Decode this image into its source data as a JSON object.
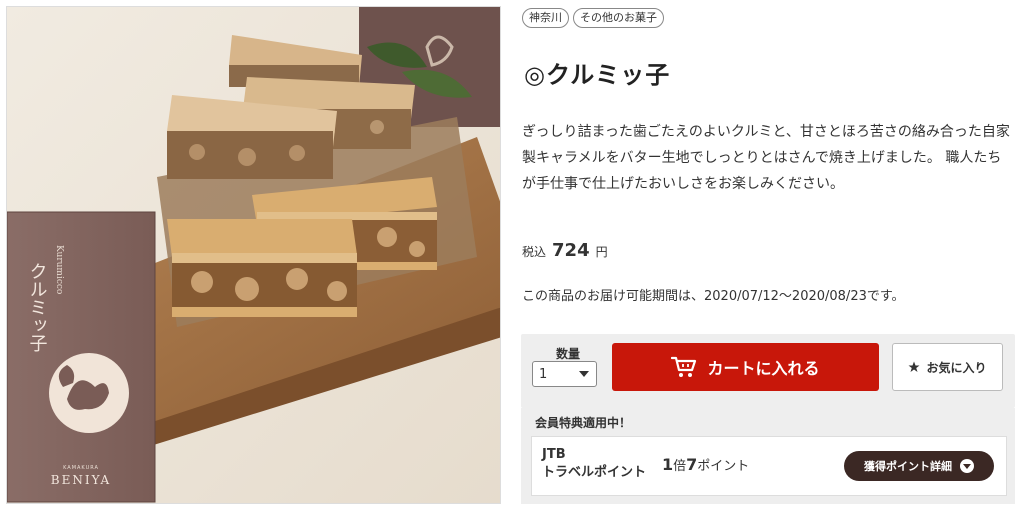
{
  "product_image": {
    "box_title": "クルミッ子",
    "box_subtitle": "Kurumicco",
    "box_brand_top": "KAMAKURA",
    "box_brand": "BENIYA"
  },
  "tags": [
    "神奈川",
    "その他のお菓子"
  ],
  "title": "◎クルミッ子",
  "description": "ぎっしり詰まった歯ごたえのよいクルミと、甘さとほろ苦さの絡み合った自家製キャラメルをバター生地でしっとりとはさんで焼き上げました。 職人たちが手仕事で仕上げたおいしさをお楽しみください。",
  "price": {
    "label": "税込",
    "value": "724",
    "unit": "円"
  },
  "delivery": "この商品のお届け可能期間は、2020/07/12～2020/08/23です。",
  "cart": {
    "qty_label": "数量",
    "qty_value": "1",
    "add_to_cart": "カートに入れる",
    "favorite": "お気に入り"
  },
  "member": {
    "label": "会員特典適用中！",
    "brand_line1": "JTB",
    "brand_line2": "トラベルポイント",
    "rate_num1": "1",
    "rate_unit1": "倍",
    "rate_num2": "7",
    "rate_unit2": "ポイント",
    "details_button": "獲得ポイント詳細"
  },
  "colors": {
    "cart_button": "#c8170a",
    "points_button": "#3b2824",
    "panel_bg": "#eeeeee"
  }
}
